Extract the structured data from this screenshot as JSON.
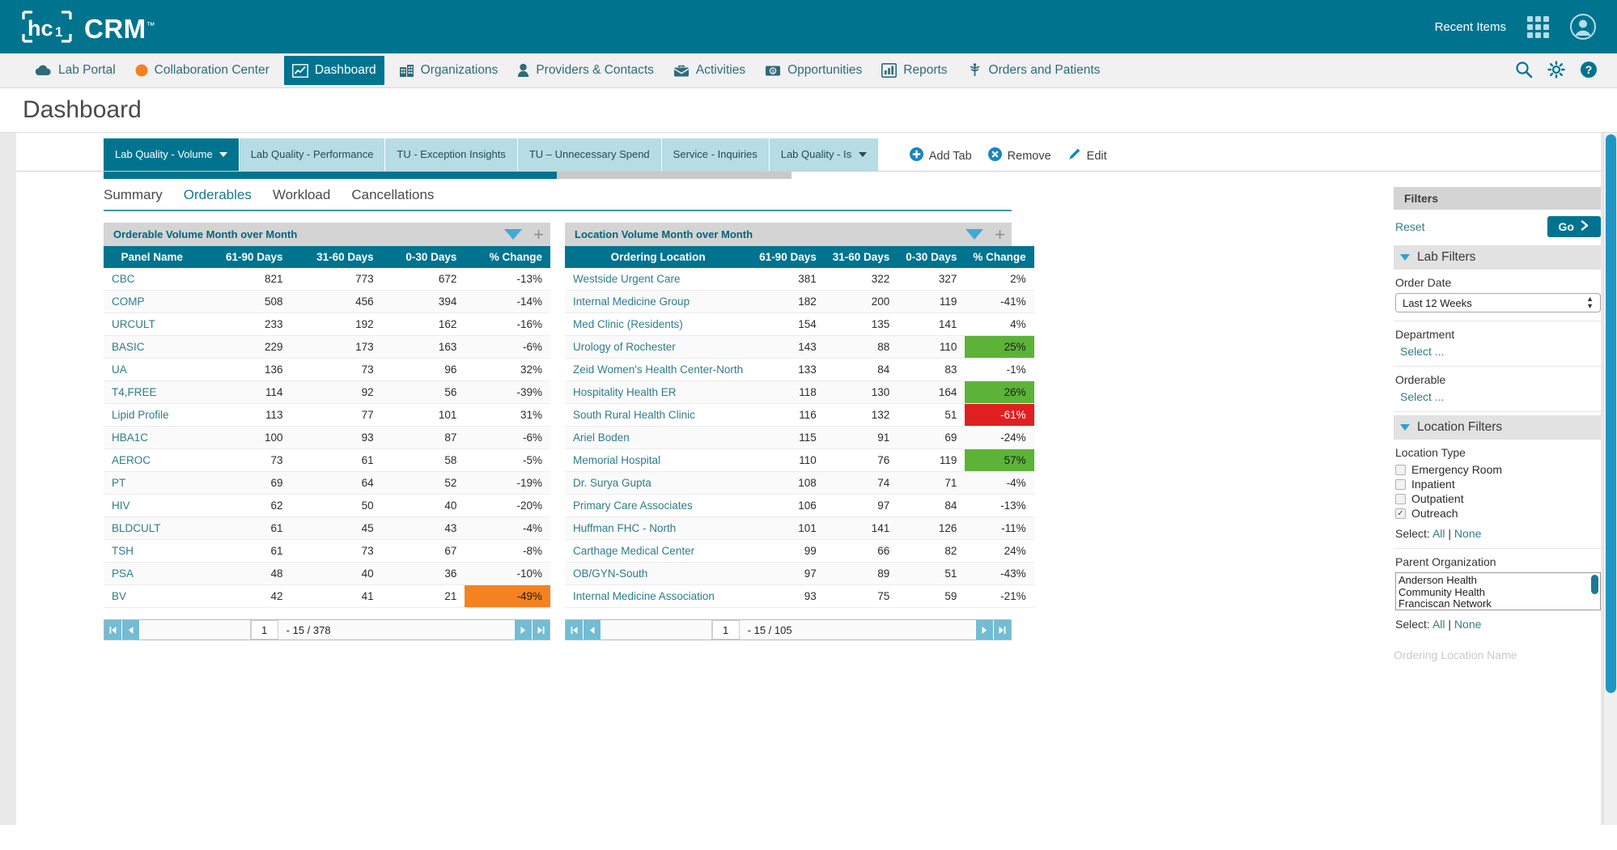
{
  "brand": {
    "logo_text": "hc1",
    "product": "CRM",
    "tm": "™",
    "recent_items": "Recent Items",
    "grid_icon": "app-grid-icon",
    "avatar_icon": "user-avatar-icon",
    "bar_color": "#00748f"
  },
  "nav": {
    "items": [
      {
        "label": "Lab Portal",
        "icon": "cloud-icon",
        "active": false
      },
      {
        "label": "Collaboration Center",
        "icon": "circle-icon",
        "active": false
      },
      {
        "label": "Dashboard",
        "icon": "chart-line-icon",
        "active": true
      },
      {
        "label": "Organizations",
        "icon": "building-icon",
        "active": false
      },
      {
        "label": "Providers & Contacts",
        "icon": "person-icon",
        "active": false
      },
      {
        "label": "Activities",
        "icon": "briefcase-icon",
        "active": false
      },
      {
        "label": "Opportunities",
        "icon": "money-icon",
        "active": false
      },
      {
        "label": "Reports",
        "icon": "bar-chart-icon",
        "active": false
      },
      {
        "label": "Orders and Patients",
        "icon": "caduceus-icon",
        "active": false
      }
    ],
    "right_icons": [
      {
        "name": "search-icon"
      },
      {
        "name": "gear-icon"
      },
      {
        "name": "help-icon"
      }
    ]
  },
  "page": {
    "title": "Dashboard"
  },
  "dashboard_tabs": {
    "tabs": [
      {
        "label": "Lab Quality - Volume",
        "active": true,
        "caret": true
      },
      {
        "label": "Lab Quality - Performance",
        "active": false,
        "caret": false
      },
      {
        "label": "TU - Exception Insights",
        "active": false,
        "caret": false
      },
      {
        "label": "TU – Unnecessary Spend",
        "active": false,
        "caret": false
      },
      {
        "label": "Service - Inquiries",
        "active": false,
        "caret": false
      },
      {
        "label": "Lab Quality - Iss",
        "active": false,
        "caret": true
      }
    ],
    "actions": [
      {
        "label": "Add Tab",
        "icon": "plus-circle-icon"
      },
      {
        "label": "Remove",
        "icon": "remove-circle-icon"
      },
      {
        "label": "Edit",
        "icon": "pencil-icon"
      }
    ]
  },
  "subtabs": [
    {
      "label": "Summary",
      "active": false
    },
    {
      "label": "Orderables",
      "active": true
    },
    {
      "label": "Workload",
      "active": false
    },
    {
      "label": "Cancellations",
      "active": false
    }
  ],
  "widgets": [
    {
      "title": "Orderable Volume Month over Month",
      "columns": [
        "Panel Name",
        "61-90 Days",
        "31-60 Days",
        "0-30 Days",
        "% Change"
      ],
      "rows": [
        {
          "name": "CBC",
          "d6190": "821",
          "d3160": "773",
          "d030": "672",
          "pct": "-13%",
          "pct_style": ""
        },
        {
          "name": "COMP",
          "d6190": "508",
          "d3160": "456",
          "d030": "394",
          "pct": "-14%",
          "pct_style": ""
        },
        {
          "name": "URCULT",
          "d6190": "233",
          "d3160": "192",
          "d030": "162",
          "pct": "-16%",
          "pct_style": ""
        },
        {
          "name": "BASIC",
          "d6190": "229",
          "d3160": "173",
          "d030": "163",
          "pct": "-6%",
          "pct_style": ""
        },
        {
          "name": "UA",
          "d6190": "136",
          "d3160": "73",
          "d030": "96",
          "pct": "32%",
          "pct_style": ""
        },
        {
          "name": "T4,FREE",
          "d6190": "114",
          "d3160": "92",
          "d030": "56",
          "pct": "-39%",
          "pct_style": ""
        },
        {
          "name": "Lipid Profile",
          "d6190": "113",
          "d3160": "77",
          "d030": "101",
          "pct": "31%",
          "pct_style": ""
        },
        {
          "name": "HBA1C",
          "d6190": "100",
          "d3160": "93",
          "d030": "87",
          "pct": "-6%",
          "pct_style": ""
        },
        {
          "name": "AEROC",
          "d6190": "73",
          "d3160": "61",
          "d030": "58",
          "pct": "-5%",
          "pct_style": ""
        },
        {
          "name": "PT",
          "d6190": "69",
          "d3160": "64",
          "d030": "52",
          "pct": "-19%",
          "pct_style": ""
        },
        {
          "name": "HIV",
          "d6190": "62",
          "d3160": "50",
          "d030": "40",
          "pct": "-20%",
          "pct_style": ""
        },
        {
          "name": "BLDCULT",
          "d6190": "61",
          "d3160": "45",
          "d030": "43",
          "pct": "-4%",
          "pct_style": ""
        },
        {
          "name": "TSH",
          "d6190": "61",
          "d3160": "73",
          "d030": "67",
          "pct": "-8%",
          "pct_style": ""
        },
        {
          "name": "PSA",
          "d6190": "48",
          "d3160": "40",
          "d030": "36",
          "pct": "-10%",
          "pct_style": ""
        },
        {
          "name": "BV",
          "d6190": "42",
          "d3160": "41",
          "d030": "21",
          "pct": "-49%",
          "pct_style": "orange"
        }
      ],
      "pager": {
        "page": "1",
        "range": "- 15 / 378"
      }
    },
    {
      "title": "Location Volume Month over Month",
      "columns": [
        "Ordering Location",
        "61-90 Days",
        "31-60 Days",
        "0-30 Days",
        "% Change"
      ],
      "rows": [
        {
          "name": "Westside Urgent Care",
          "d6190": "381",
          "d3160": "322",
          "d030": "327",
          "pct": "2%",
          "pct_style": ""
        },
        {
          "name": "Internal Medicine Group",
          "d6190": "182",
          "d3160": "200",
          "d030": "119",
          "pct": "-41%",
          "pct_style": ""
        },
        {
          "name": "Med Clinic (Residents)",
          "d6190": "154",
          "d3160": "135",
          "d030": "141",
          "pct": "4%",
          "pct_style": ""
        },
        {
          "name": "Urology of Rochester",
          "d6190": "143",
          "d3160": "88",
          "d030": "110",
          "pct": "25%",
          "pct_style": "green"
        },
        {
          "name": "Zeid Women's Health Center-North",
          "d6190": "133",
          "d3160": "84",
          "d030": "83",
          "pct": "-1%",
          "pct_style": ""
        },
        {
          "name": "Hospitality Health ER",
          "d6190": "118",
          "d3160": "130",
          "d030": "164",
          "pct": "26%",
          "pct_style": "green"
        },
        {
          "name": "South Rural Health Clinic",
          "d6190": "116",
          "d3160": "132",
          "d030": "51",
          "pct": "-61%",
          "pct_style": "red"
        },
        {
          "name": "Ariel Boden",
          "d6190": "115",
          "d3160": "91",
          "d030": "69",
          "pct": "-24%",
          "pct_style": ""
        },
        {
          "name": "Memorial Hospital",
          "d6190": "110",
          "d3160": "76",
          "d030": "119",
          "pct": "57%",
          "pct_style": "green"
        },
        {
          "name": "Dr. Surya Gupta",
          "d6190": "108",
          "d3160": "74",
          "d030": "71",
          "pct": "-4%",
          "pct_style": ""
        },
        {
          "name": "Primary Care Associates",
          "d6190": "106",
          "d3160": "97",
          "d030": "84",
          "pct": "-13%",
          "pct_style": ""
        },
        {
          "name": "Huffman FHC - North",
          "d6190": "101",
          "d3160": "141",
          "d030": "126",
          "pct": "-11%",
          "pct_style": ""
        },
        {
          "name": "Carthage Medical Center",
          "d6190": "99",
          "d3160": "66",
          "d030": "82",
          "pct": "24%",
          "pct_style": ""
        },
        {
          "name": "OB/GYN-South",
          "d6190": "97",
          "d3160": "89",
          "d030": "51",
          "pct": "-43%",
          "pct_style": ""
        },
        {
          "name": "Internal Medicine Association",
          "d6190": "93",
          "d3160": "75",
          "d030": "59",
          "pct": "-21%",
          "pct_style": ""
        }
      ],
      "pager": {
        "page": "1",
        "range": "- 15 / 105"
      }
    }
  ],
  "filters": {
    "header": "Filters",
    "reset": "Reset",
    "go": "Go",
    "lab_section": "Lab Filters",
    "order_date_label": "Order Date",
    "order_date_value": "Last 12 Weeks",
    "department_label": "Department",
    "department_value": "Select ...",
    "orderable_label": "Orderable",
    "orderable_value": "Select ...",
    "location_section": "Location Filters",
    "location_type_label": "Location Type",
    "location_types": [
      {
        "label": "Emergency Room",
        "checked": false
      },
      {
        "label": "Inpatient",
        "checked": false
      },
      {
        "label": "Outpatient",
        "checked": false
      },
      {
        "label": "Outreach",
        "checked": true
      }
    ],
    "select_prefix": "Select:",
    "select_all": "All",
    "select_sep": "|",
    "select_none": "None",
    "parent_org_label": "Parent Organization",
    "parent_orgs": [
      "Anderson Health",
      "Community Health",
      "Franciscan Network"
    ],
    "next_label": "Ordering Location Name"
  },
  "colors": {
    "teal": "#00748f",
    "green": "#5cb338",
    "red": "#e02020",
    "orange": "#f58220"
  }
}
